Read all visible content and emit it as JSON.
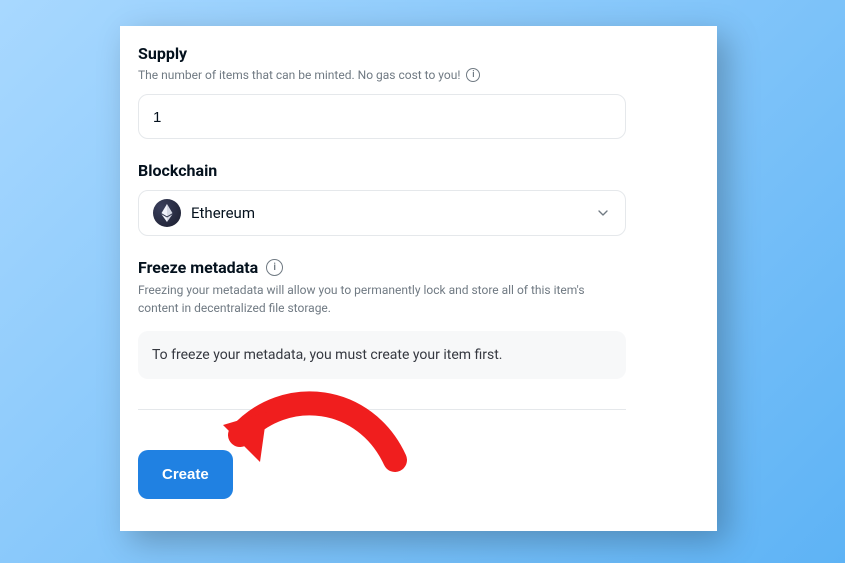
{
  "supply": {
    "label": "Supply",
    "sub": "The number of items that can be minted. No gas cost to you!",
    "value": "1"
  },
  "blockchain": {
    "label": "Blockchain",
    "selected": "Ethereum"
  },
  "freeze": {
    "label": "Freeze metadata",
    "desc": "Freezing your metadata will allow you to permanently lock and store all of this item's content in decentralized file storage.",
    "notice": "To freeze your metadata, you must create your item first."
  },
  "create_label": "Create"
}
